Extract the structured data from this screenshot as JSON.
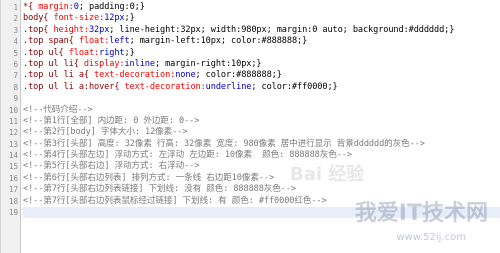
{
  "editor": {
    "lines": [
      {
        "n": "1",
        "sel": "*{ ",
        "prop": "margin:",
        "val": "0",
        "rest": "; padding:0;}",
        "kind": "code"
      },
      {
        "n": "2",
        "sel": "body{ ",
        "prop": "font-size:",
        "val": "12px",
        "rest": ";}",
        "kind": "code"
      },
      {
        "n": "3",
        "sel": ".top{ ",
        "prop": "height:",
        "val": "32px",
        "rest": "; line-height:32px; width:980px; margin:0 auto; background:#dddddd;}",
        "kind": "code"
      },
      {
        "n": "4",
        "sel": ".top span{ ",
        "prop": "float:",
        "val": "left",
        "rest": "; margin-left:10px; color:#888888;}",
        "kind": "code"
      },
      {
        "n": "5",
        "sel": ".top ul{ ",
        "prop": "float:",
        "val": "right",
        "rest": ";}",
        "kind": "code"
      },
      {
        "n": "6",
        "sel": ".top ul li{ ",
        "prop": "display:",
        "val": "inline",
        "rest": "; margin-right:10px;}",
        "kind": "code"
      },
      {
        "n": "7",
        "sel": ".top ul li a{ ",
        "prop": "text-decoration:",
        "val": "none",
        "rest": "; color:#888888;}",
        "kind": "code"
      },
      {
        "n": "8",
        "sel": ".top ul li a:hover{ ",
        "prop": "text-decoration:",
        "val": "underline",
        "rest": "; color:#ff0000;}",
        "kind": "code"
      },
      {
        "n": "9",
        "text": "",
        "kind": "blank"
      },
      {
        "n": "10",
        "text": "<!--代码介绍-->",
        "kind": "comment"
      },
      {
        "n": "11",
        "text": "<!--第1行[全部] 内边距: 0 外边距: 0-->",
        "kind": "comment"
      },
      {
        "n": "12",
        "text": "<!--第2行[body] 字体大小: 12像素-->",
        "kind": "comment"
      },
      {
        "n": "13",
        "text": "<!--第3行[头部] 高度: 32像素 行高: 32像素 宽度: 980像素 居中进行显示 背景dddddd的灰色-->",
        "kind": "comment"
      },
      {
        "n": "14",
        "text": "<!--第4行[头部左边] 浮动方式: 左浮动 左边距: 10像素  颜色: 888888灰色-->",
        "kind": "comment"
      },
      {
        "n": "15",
        "text": "<!--第5行[头部右边] 浮动方式: 右浮动-->",
        "kind": "comment"
      },
      {
        "n": "16",
        "text": "<!--第6行[头部右边列表] 排列方式: 一条线 右边距10像素-->",
        "kind": "comment"
      },
      {
        "n": "17",
        "text": "<!--第7行[头部右边列表链接] 下划线: 没有 颜色: 888888灰色-->",
        "kind": "comment"
      },
      {
        "n": "18",
        "text": "<!--第7行[头部右边列表鼠标经过链接] 下划线: 有 颜色: #ff0000红色-->",
        "kind": "comment"
      },
      {
        "n": "19",
        "text": "",
        "kind": "blank"
      }
    ]
  },
  "watermark": {
    "text": "我爱IT技术网",
    "url": "www.52ij.com",
    "baidu": "Bai 经验"
  }
}
